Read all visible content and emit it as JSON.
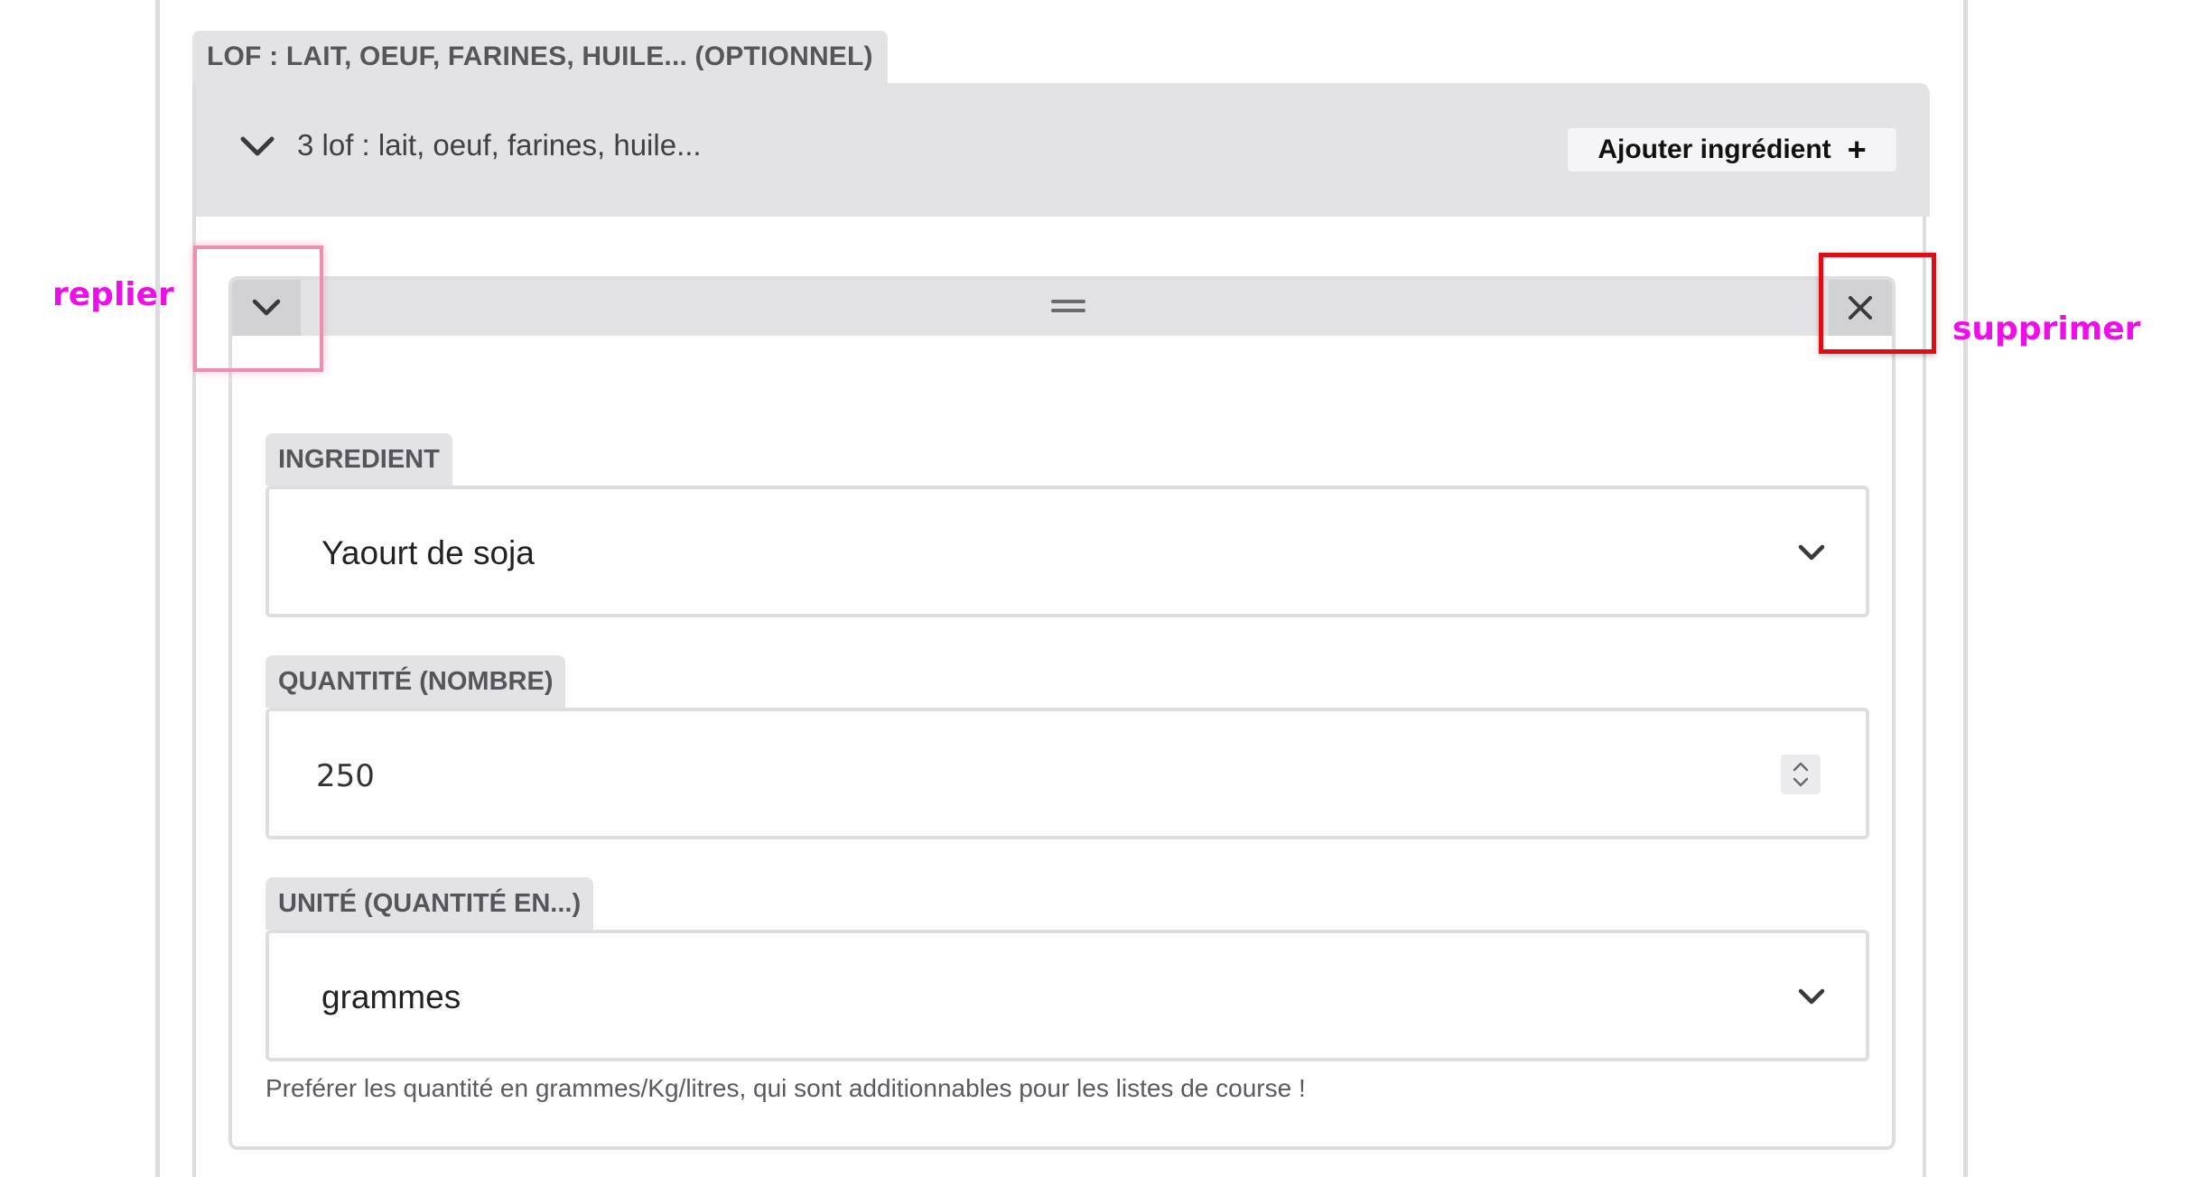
{
  "section": {
    "tab_label": "LOF : LAIT, OEUF, FARINES, HUILE... (OPTIONNEL)",
    "group_title": "3 lof : lait, oeuf, farines, huile...",
    "add_button_label": "Ajouter ingrédient",
    "add_button_icon": "plus-icon"
  },
  "item": {
    "collapse_icon": "chevron-down-icon",
    "drag_icon": "drag-handle-icon",
    "delete_icon": "close-icon",
    "fields": {
      "ingredient": {
        "label": "INGREDIENT",
        "value": "Yaourt de soja"
      },
      "quantity": {
        "label": "QUANTITÉ (NOMBRE)",
        "value": "250"
      },
      "unit": {
        "label": "UNITÉ (QUANTITÉ EN...)",
        "value": "grammes"
      }
    },
    "help_text": "Preférer les quantité en grammes/Kg/litres, qui sont additionnables pour les listes de course !"
  },
  "annotations": {
    "collapse_label": "replier",
    "delete_label": "supprimer",
    "collapse_color": "#ee0ee8",
    "delete_box_color": "#e20d14"
  },
  "colors": {
    "panel_gray": "#e3e3e6",
    "border_gray": "#dedee2",
    "annotation_magenta": "#ee0ee8"
  }
}
